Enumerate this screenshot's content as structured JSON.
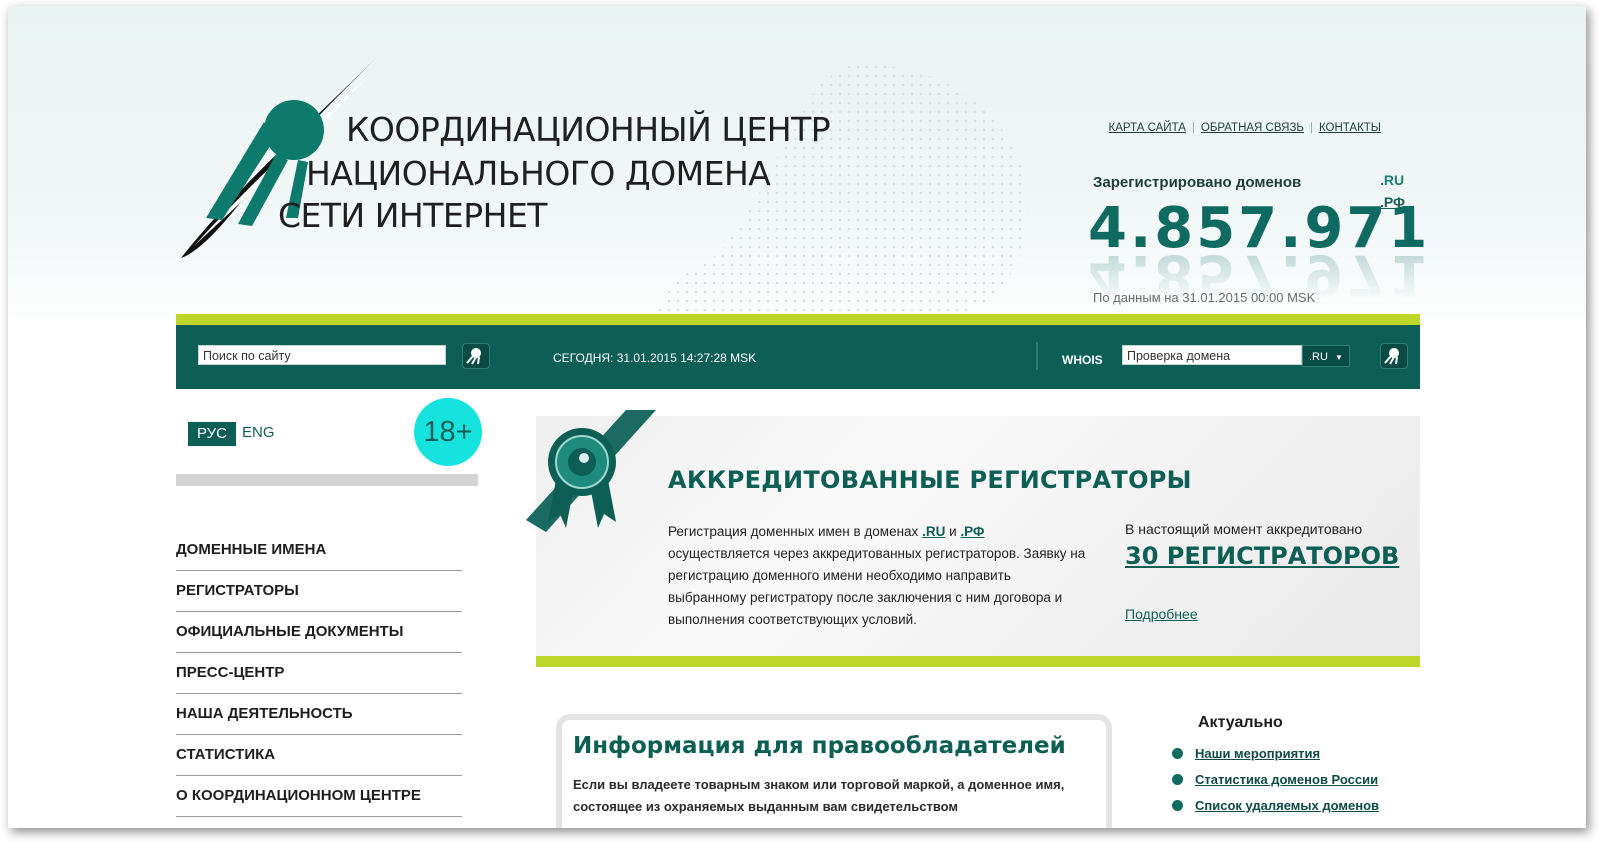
{
  "logo": {
    "line1": "КООРДИНАЦИОННЫЙ ЦЕНТР",
    "line2": "НАЦИОНАЛЬНОГО ДОМЕНА",
    "line3": "СЕТИ ИНТЕРНЕТ"
  },
  "top_links": [
    "КАРТА САЙТА",
    "ОБРАТНАЯ СВЯЗЬ",
    "КОНТАКТЫ"
  ],
  "counter": {
    "label": "Зарегистрировано доменов",
    "value": "4.857.971",
    "zone_ru": ".RU",
    "zone_rf": ".РФ",
    "as_of": "По данным на 31.01.2015 00:00 MSK"
  },
  "bar": {
    "search_value": "Поиск по сайту",
    "today": "СЕГОДНЯ: 31.01.2015 14:27:28 MSK",
    "whois_label": "WHOIS",
    "whois_value": "Проверка домена",
    "zone_selected": ".RU"
  },
  "lang": {
    "ru": "РУС",
    "en": "ENG"
  },
  "age_badge": "18+",
  "nav": [
    "ДОМЕННЫЕ ИМЕНА",
    "РЕГИСТРАТОРЫ",
    "ОФИЦИАЛЬНЫЕ ДОКУМЕНТЫ",
    "ПРЕСС-ЦЕНТР",
    "НАША ДЕЯТЕЛЬНОСТЬ",
    "СТАТИСТИКА",
    "О КООРДИНАЦИОННОМ ЦЕНТРЕ"
  ],
  "banner": {
    "title": "АККРЕДИТОВАННЫЕ РЕГИСТРАТОРЫ",
    "text_before": "Регистрация доменных имен в доменах ",
    "link_ru": ".RU",
    "text_and": " и ",
    "link_rf": ".РФ",
    "text_after": " осуществляется через аккредитованных регистраторов. Заявку на регистрацию доменного имени необходимо направить выбранному регистратору после заключения с ним договора и выполнения соответствующих условий.",
    "acc_label": "В настоящий момент аккредитовано",
    "acc_count": "30 РЕГИСТРАТОРОВ",
    "more": "Подробнее"
  },
  "info": {
    "title": "Информация для правообладателей",
    "text": "Если вы владеете товарным знаком или торговой маркой, а доменное имя, состоящее из охраняемых выданным вам свидетельством"
  },
  "actual": {
    "title": "Актуально",
    "items": [
      "Наши мероприятия",
      "Статистика доменов России",
      "Список удаляемых доменов"
    ]
  },
  "colors": {
    "brand": "#0d5f55",
    "accent": "#bcd62a",
    "badge": "#17e3de"
  }
}
